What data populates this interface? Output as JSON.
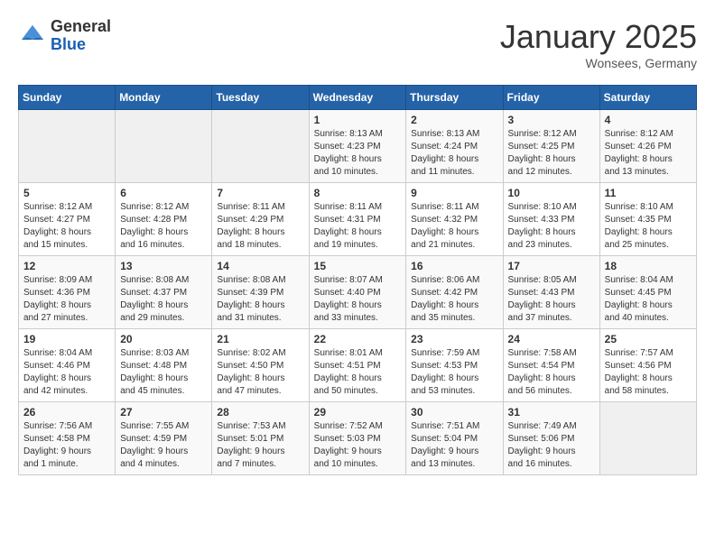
{
  "header": {
    "logo_general": "General",
    "logo_blue": "Blue",
    "month_title": "January 2025",
    "location": "Wonsees, Germany"
  },
  "weekdays": [
    "Sunday",
    "Monday",
    "Tuesday",
    "Wednesday",
    "Thursday",
    "Friday",
    "Saturday"
  ],
  "weeks": [
    [
      {
        "day": "",
        "info": ""
      },
      {
        "day": "",
        "info": ""
      },
      {
        "day": "",
        "info": ""
      },
      {
        "day": "1",
        "info": "Sunrise: 8:13 AM\nSunset: 4:23 PM\nDaylight: 8 hours\nand 10 minutes."
      },
      {
        "day": "2",
        "info": "Sunrise: 8:13 AM\nSunset: 4:24 PM\nDaylight: 8 hours\nand 11 minutes."
      },
      {
        "day": "3",
        "info": "Sunrise: 8:12 AM\nSunset: 4:25 PM\nDaylight: 8 hours\nand 12 minutes."
      },
      {
        "day": "4",
        "info": "Sunrise: 8:12 AM\nSunset: 4:26 PM\nDaylight: 8 hours\nand 13 minutes."
      }
    ],
    [
      {
        "day": "5",
        "info": "Sunrise: 8:12 AM\nSunset: 4:27 PM\nDaylight: 8 hours\nand 15 minutes."
      },
      {
        "day": "6",
        "info": "Sunrise: 8:12 AM\nSunset: 4:28 PM\nDaylight: 8 hours\nand 16 minutes."
      },
      {
        "day": "7",
        "info": "Sunrise: 8:11 AM\nSunset: 4:29 PM\nDaylight: 8 hours\nand 18 minutes."
      },
      {
        "day": "8",
        "info": "Sunrise: 8:11 AM\nSunset: 4:31 PM\nDaylight: 8 hours\nand 19 minutes."
      },
      {
        "day": "9",
        "info": "Sunrise: 8:11 AM\nSunset: 4:32 PM\nDaylight: 8 hours\nand 21 minutes."
      },
      {
        "day": "10",
        "info": "Sunrise: 8:10 AM\nSunset: 4:33 PM\nDaylight: 8 hours\nand 23 minutes."
      },
      {
        "day": "11",
        "info": "Sunrise: 8:10 AM\nSunset: 4:35 PM\nDaylight: 8 hours\nand 25 minutes."
      }
    ],
    [
      {
        "day": "12",
        "info": "Sunrise: 8:09 AM\nSunset: 4:36 PM\nDaylight: 8 hours\nand 27 minutes."
      },
      {
        "day": "13",
        "info": "Sunrise: 8:08 AM\nSunset: 4:37 PM\nDaylight: 8 hours\nand 29 minutes."
      },
      {
        "day": "14",
        "info": "Sunrise: 8:08 AM\nSunset: 4:39 PM\nDaylight: 8 hours\nand 31 minutes."
      },
      {
        "day": "15",
        "info": "Sunrise: 8:07 AM\nSunset: 4:40 PM\nDaylight: 8 hours\nand 33 minutes."
      },
      {
        "day": "16",
        "info": "Sunrise: 8:06 AM\nSunset: 4:42 PM\nDaylight: 8 hours\nand 35 minutes."
      },
      {
        "day": "17",
        "info": "Sunrise: 8:05 AM\nSunset: 4:43 PM\nDaylight: 8 hours\nand 37 minutes."
      },
      {
        "day": "18",
        "info": "Sunrise: 8:04 AM\nSunset: 4:45 PM\nDaylight: 8 hours\nand 40 minutes."
      }
    ],
    [
      {
        "day": "19",
        "info": "Sunrise: 8:04 AM\nSunset: 4:46 PM\nDaylight: 8 hours\nand 42 minutes."
      },
      {
        "day": "20",
        "info": "Sunrise: 8:03 AM\nSunset: 4:48 PM\nDaylight: 8 hours\nand 45 minutes."
      },
      {
        "day": "21",
        "info": "Sunrise: 8:02 AM\nSunset: 4:50 PM\nDaylight: 8 hours\nand 47 minutes."
      },
      {
        "day": "22",
        "info": "Sunrise: 8:01 AM\nSunset: 4:51 PM\nDaylight: 8 hours\nand 50 minutes."
      },
      {
        "day": "23",
        "info": "Sunrise: 7:59 AM\nSunset: 4:53 PM\nDaylight: 8 hours\nand 53 minutes."
      },
      {
        "day": "24",
        "info": "Sunrise: 7:58 AM\nSunset: 4:54 PM\nDaylight: 8 hours\nand 56 minutes."
      },
      {
        "day": "25",
        "info": "Sunrise: 7:57 AM\nSunset: 4:56 PM\nDaylight: 8 hours\nand 58 minutes."
      }
    ],
    [
      {
        "day": "26",
        "info": "Sunrise: 7:56 AM\nSunset: 4:58 PM\nDaylight: 9 hours\nand 1 minute."
      },
      {
        "day": "27",
        "info": "Sunrise: 7:55 AM\nSunset: 4:59 PM\nDaylight: 9 hours\nand 4 minutes."
      },
      {
        "day": "28",
        "info": "Sunrise: 7:53 AM\nSunset: 5:01 PM\nDaylight: 9 hours\nand 7 minutes."
      },
      {
        "day": "29",
        "info": "Sunrise: 7:52 AM\nSunset: 5:03 PM\nDaylight: 9 hours\nand 10 minutes."
      },
      {
        "day": "30",
        "info": "Sunrise: 7:51 AM\nSunset: 5:04 PM\nDaylight: 9 hours\nand 13 minutes."
      },
      {
        "day": "31",
        "info": "Sunrise: 7:49 AM\nSunset: 5:06 PM\nDaylight: 9 hours\nand 16 minutes."
      },
      {
        "day": "",
        "info": ""
      }
    ]
  ]
}
